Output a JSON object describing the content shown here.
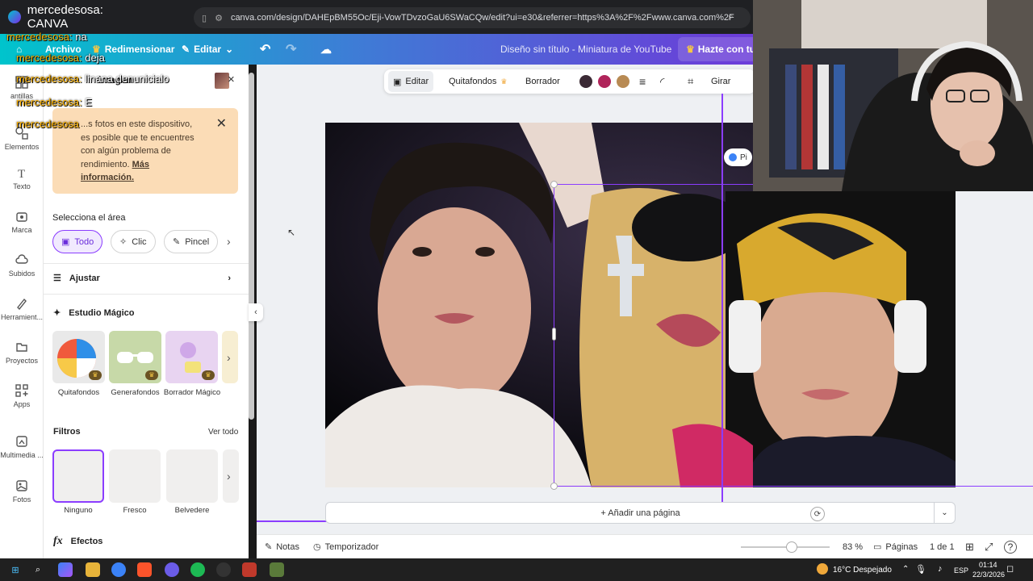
{
  "browser": {
    "tab_title": "mercedesosa: CANVA",
    "url": "canva.com/design/DAHEpBM55Oc/Eji-VowTDvzoGaU6SWaCQw/edit?ui=e30&referrer=https%3A%2F%2Fwww.canva.com%2F"
  },
  "header": {
    "menu_file": "Archivo",
    "resize": "Redimensionar",
    "edit": "Editar",
    "doc_title": "Diseño sin título - Miniatura de YouTube",
    "upgrade": "Hazte con tu p"
  },
  "chat_overlay": [
    {
      "user": "mercedesosa",
      "msg": "na"
    },
    {
      "user": "mercedesosa",
      "msg": "deja"
    },
    {
      "user": "mercedesosa",
      "msg": "linana denunicialo"
    },
    {
      "user": "mercedesosa",
      "msg": "E"
    },
    {
      "user": "mercedesosa",
      "msg": ""
    }
  ],
  "rail": {
    "items": [
      "Elementos",
      "Texto",
      "Marca",
      "Subidos",
      "Herramient...",
      "Proyectos",
      "Apps",
      "Multimedia ...",
      "Fotos"
    ],
    "partial_label": "antillas"
  },
  "panel": {
    "header_partial": "imagen",
    "notice_text": "...s fotos en este dispositivo, es posible que te encuentres con algún problema de rendimiento.",
    "notice_link": "Más información.",
    "select_area_title": "Selecciona el área",
    "select_options": [
      "Todo",
      "Clic",
      "Pincel"
    ],
    "adjust": "Ajustar",
    "magic_studio": "Estudio Mágico",
    "magic_tools": [
      "Quitafondos",
      "Generafondos",
      "Borrador Mágico"
    ],
    "filters_title": "Filtros",
    "see_all": "Ver todo",
    "filters": [
      "Ninguno",
      "Fresco",
      "Belvedere"
    ],
    "effects": "Efectos"
  },
  "toolbar": {
    "edit": "Editar",
    "remove_bg": "Quitafondos",
    "eraser": "Borrador",
    "rotate": "Girar",
    "colors": [
      "#3b2a35",
      "#b0245a",
      "#b88a53"
    ]
  },
  "canvas": {
    "add_page": "+ Añadir una página",
    "partial_badge": "Pi"
  },
  "bottom": {
    "notes": "Notas",
    "timer": "Temporizador",
    "zoom": "83 %",
    "pages": "Páginas",
    "page_count": "1 de 1"
  },
  "taskbar": {
    "weather": "16°C  Despejado",
    "lang": "ESP",
    "time": "01:14",
    "date": "22/3/2026"
  }
}
